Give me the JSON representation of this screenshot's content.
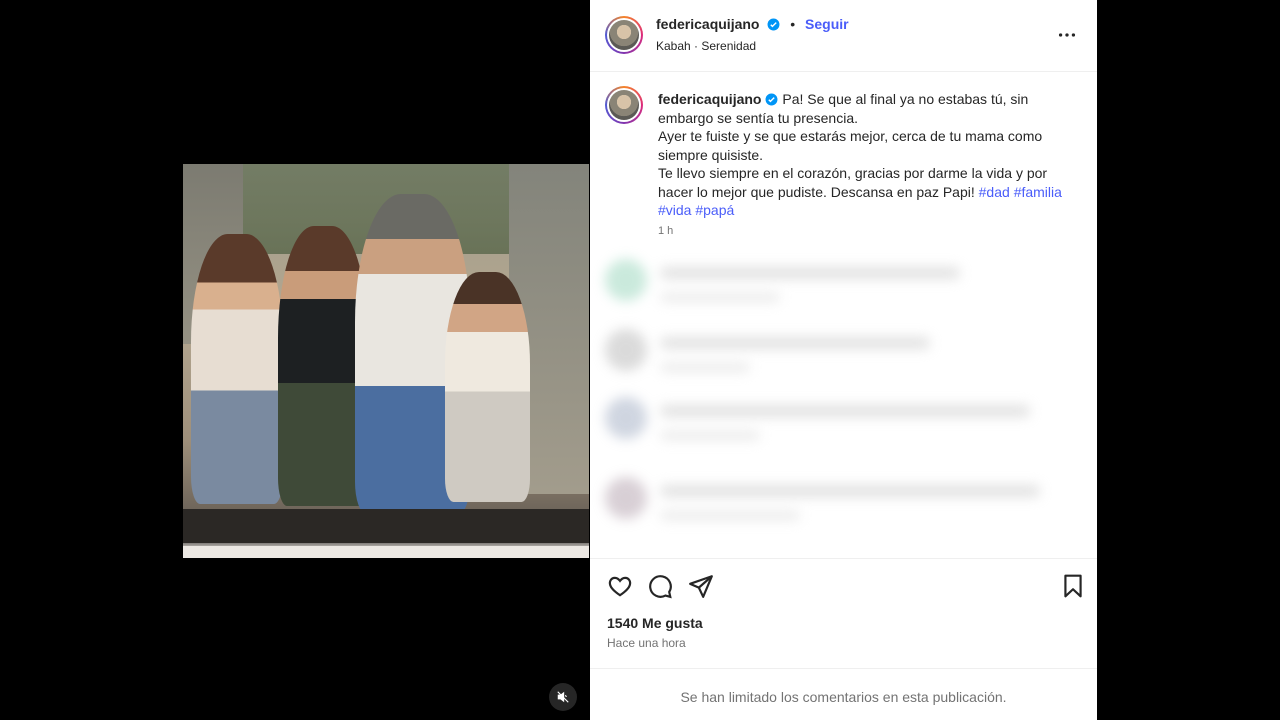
{
  "post": {
    "username": "federicaquijano",
    "follow_label": "Seguir",
    "separator": "•",
    "location": "Kabah · Serenidad",
    "caption_username": "federicaquijano",
    "caption_lines": [
      "Pa! Se que al final ya no estabas tú, sin embargo se sentía tu presencia.",
      "Ayer te fuiste y se que estarás mejor, cerca de tu mama como siempre quisiste.",
      "Te llevo siempre en el corazón, gracias por darme la vida y por hacer lo mejor que pudiste. Descansa en paz Papi!"
    ],
    "hashtags": [
      "#dad",
      "#familia",
      "#vida",
      "#papá"
    ],
    "caption_time": "1 h",
    "likes": "1540 Me gusta",
    "time_ago": "Hace una hora",
    "comments_limited": "Se han limitado los comentarios en esta publicación."
  },
  "icons": {
    "verified": "verified-badge-icon",
    "more": "more-options-icon",
    "like": "heart-icon",
    "comment": "comment-icon",
    "share": "share-icon",
    "save": "bookmark-icon",
    "mute": "muted-audio-icon"
  },
  "colors": {
    "link": "#4a5df9",
    "verified": "#0095f6",
    "muted_text": "#737373",
    "text": "#262626"
  }
}
